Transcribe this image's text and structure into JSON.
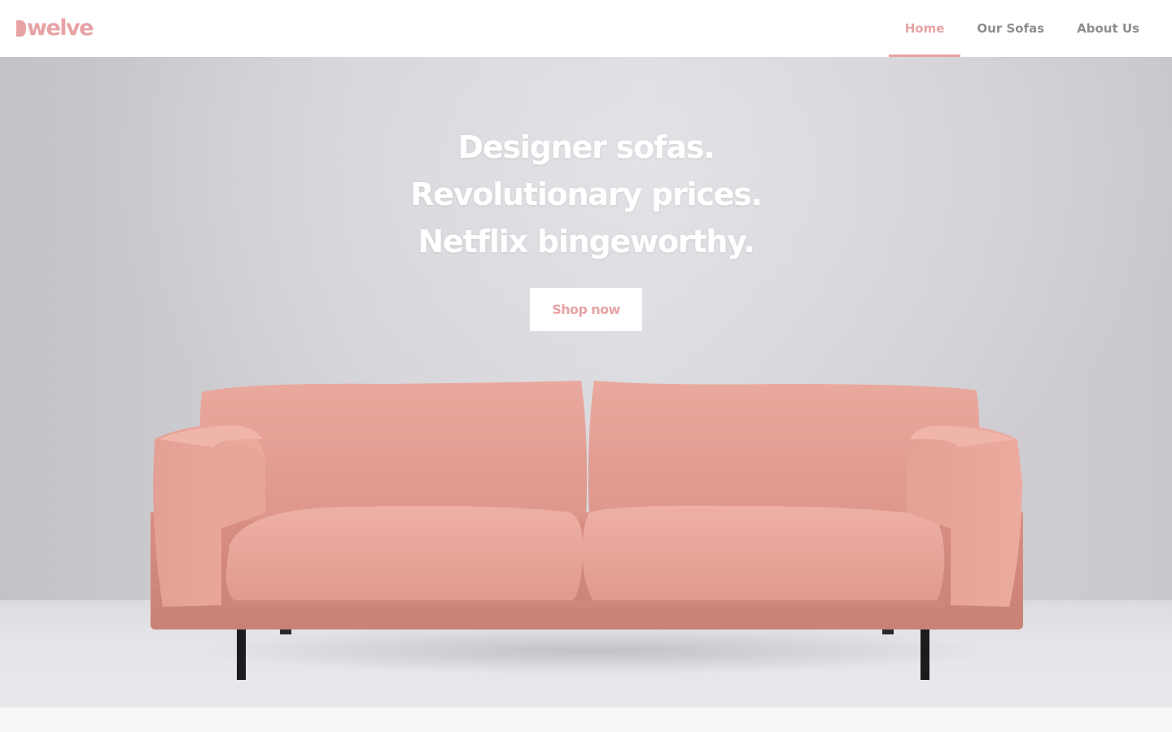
{
  "brand": {
    "name": "Dwelve",
    "logo_text": "welve"
  },
  "nav": {
    "items": [
      {
        "label": "Home",
        "active": true
      },
      {
        "label": "Our Sofas",
        "active": false
      },
      {
        "label": "About Us",
        "active": false
      }
    ]
  },
  "hero": {
    "headline_lines": [
      "Designer sofas.",
      "Revolutionary prices.",
      "Netflix bingeworthy."
    ],
    "cta_label": "Shop now",
    "image": "sofa-photo"
  },
  "colors": {
    "accent": "#e7a3a4",
    "nav_text": "#8e8e8e",
    "sofa": "#e4a196",
    "sofa_dark": "#c98478",
    "legs": "#1c1c1e"
  }
}
